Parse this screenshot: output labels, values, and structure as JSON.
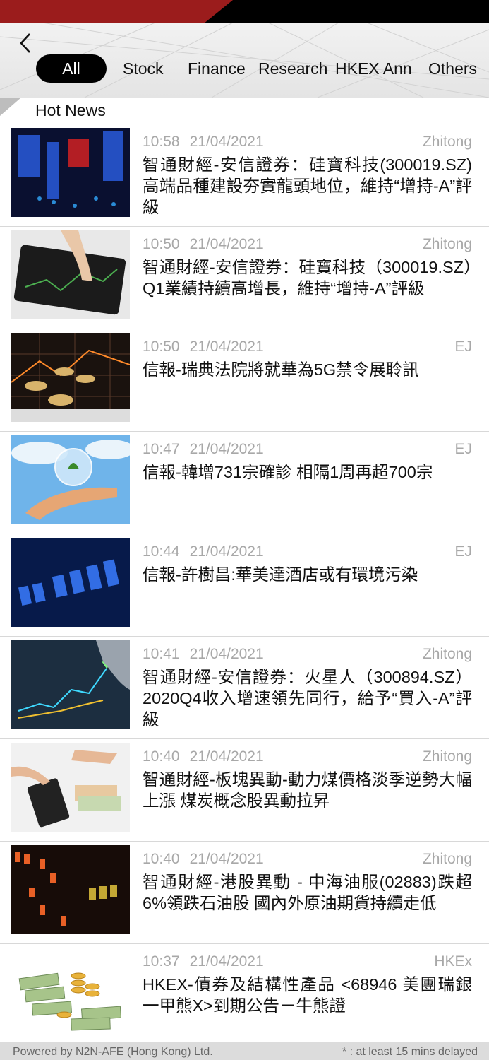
{
  "nav": {
    "tabs": [
      {
        "label": "All",
        "active": true
      },
      {
        "label": "Stock"
      },
      {
        "label": "Finance"
      },
      {
        "label": "Research"
      },
      {
        "label": "HKEX Ann"
      },
      {
        "label": "Others"
      }
    ],
    "back_icon": "chevron-left-icon"
  },
  "section": {
    "title": "Hot News"
  },
  "news": [
    {
      "time": "10:58",
      "date": "21/04/2021",
      "source": "Zhitong",
      "headline": "智通財經-安信證券：硅寶科技(300019.SZ)高端品種建設夯實龍頭地位，維持“增持-A”評級",
      "thumb": "stock-board-image"
    },
    {
      "time": "10:50",
      "date": "21/04/2021",
      "source": "Zhitong",
      "headline": "智通財經-安信證券：硅寶科技（300019.SZ）Q1業績持續高增長，維持“增持-A”評級",
      "thumb": "tablet-chart-image"
    },
    {
      "time": "10:50",
      "date": "21/04/2021",
      "source": "EJ",
      "headline": "信報-瑞典法院將就華為5G禁令展聆訊",
      "thumb": "coins-chart-image"
    },
    {
      "time": "10:47",
      "date": "21/04/2021",
      "source": "EJ",
      "headline": "信報-韓增731宗確診 相隔1周再超700宗",
      "thumb": "hand-bubble-image"
    },
    {
      "time": "10:44",
      "date": "21/04/2021",
      "source": "EJ",
      "headline": "信報-許樹昌:華美達酒店或有環境污染",
      "thumb": "digital-numbers-image"
    },
    {
      "time": "10:41",
      "date": "21/04/2021",
      "source": "Zhitong",
      "headline": "智通財經-安信證券：火星人（300894.SZ）2020Q4收入增速領先同行，給予“買入-A”評級",
      "thumb": "touch-graph-image"
    },
    {
      "time": "10:40",
      "date": "21/04/2021",
      "source": "Zhitong",
      "headline": "智通財經-板塊異動-動力煤價格淡季逆勢大幅上漲 煤炭概念股異動拉昇",
      "thumb": "calculator-money-image"
    },
    {
      "time": "10:40",
      "date": "21/04/2021",
      "source": "Zhitong",
      "headline": "智通財經-港股異動 - 中海油服(02883)跌超6%領跌石油股 國內外原油期貨持續走低",
      "thumb": "led-ticker-image"
    },
    {
      "time": "10:37",
      "date": "21/04/2021",
      "source": "HKEx",
      "headline": "HKEX-債券及結構性產品 <68946 美團瑞銀一甲熊X>到期公告－牛熊證",
      "thumb": "cash-stack-image"
    }
  ],
  "footer": {
    "powered_by": "Powered by N2N-AFE (Hong Kong) Ltd.",
    "delay_note": "* : at least 15 mins delayed"
  },
  "colors": {
    "accent_red": "#9b1c1c",
    "tab_active_bg": "#000000",
    "meta_grey": "#a8a8a8"
  }
}
